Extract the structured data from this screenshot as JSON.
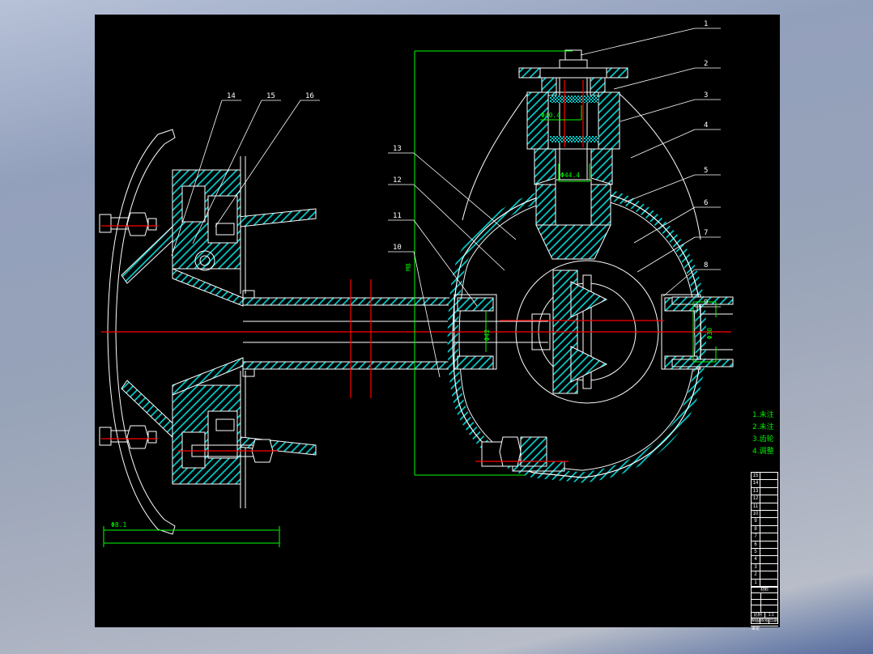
{
  "drawing": {
    "callouts_right": [
      "1",
      "2",
      "3",
      "4",
      "5",
      "6",
      "7",
      "8",
      "9"
    ],
    "callouts_mid": [
      "13",
      "12",
      "11",
      "10"
    ],
    "callouts_left": [
      "14",
      "15",
      "16"
    ],
    "dims": {
      "pinion_top": "Φ40.4",
      "pinion_lower": "Φ44.4",
      "axle_center": "Φ42",
      "right_shaft": "Φ30",
      "hub_width": "Φ8.1",
      "mid_small": "M8"
    },
    "notes": [
      "1.未注",
      "2.未注",
      "3.齿轮",
      "4.调整"
    ],
    "bom": {
      "rows": [
        "15",
        "14",
        "13",
        "12",
        "11",
        "10",
        "9",
        "8",
        "7",
        "6",
        "5",
        "4",
        "3",
        "2",
        "1"
      ]
    },
    "title_block": {
      "header": "材料",
      "scale_label": "比例",
      "scale_value": "1:1",
      "draw_label": "制图",
      "check_label": "校核",
      "date_label": "日期",
      "approve_label": "审定"
    },
    "colors": {
      "outline": "#ffffff",
      "hatch": "#00dcdc",
      "centerline": "#ff0000",
      "dimension": "#00ff00",
      "canvas_background": "#000000"
    }
  }
}
